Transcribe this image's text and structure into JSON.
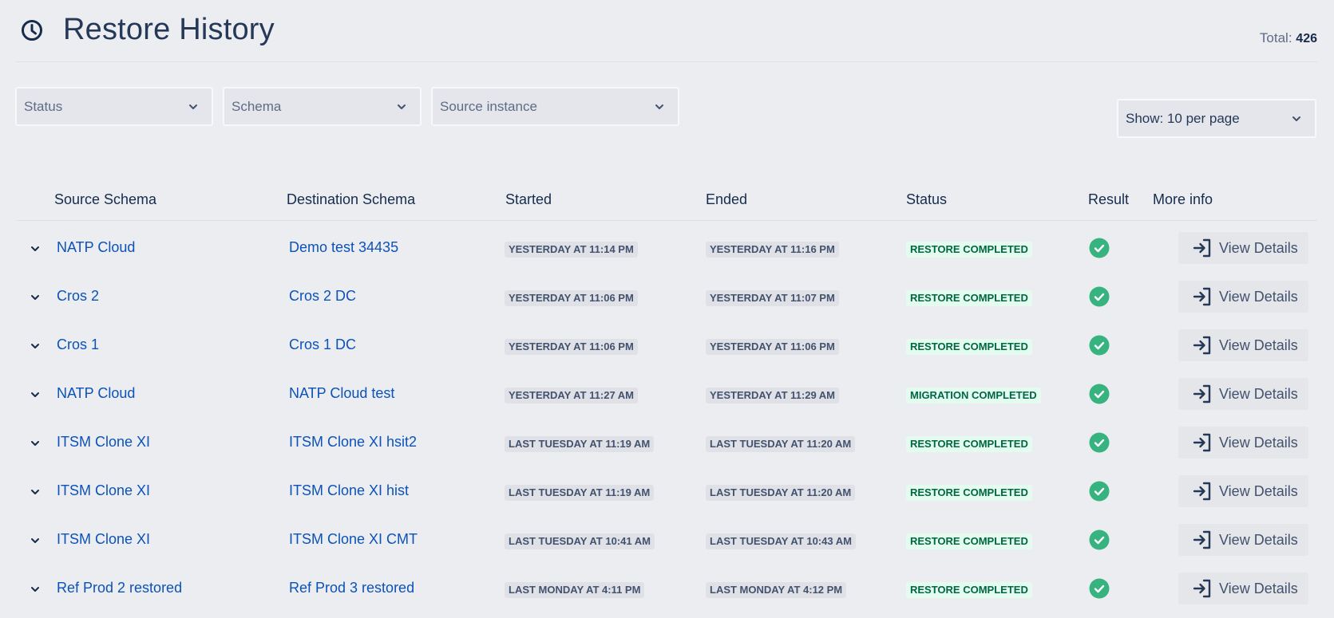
{
  "header": {
    "title": "Restore History",
    "total_label": "Total:",
    "total_value": "426",
    "icon": "clock-icon"
  },
  "filters": {
    "status_placeholder": "Status",
    "schema_placeholder": "Schema",
    "source_instance_placeholder": "Source instance",
    "page_size": "Show: 10 per page"
  },
  "table": {
    "columns": [
      "Source Schema",
      "Destination Schema",
      "Started",
      "Ended",
      "Status",
      "Result",
      "More info"
    ],
    "view_details_label": "View Details",
    "rows": [
      {
        "source": "NATP Cloud",
        "destination": "Demo test 34435",
        "started": "YESTERDAY AT 11:14 PM",
        "ended": "YESTERDAY AT 11:16 PM",
        "status": "RESTORE COMPLETED"
      },
      {
        "source": "Cros 2",
        "destination": "Cros 2 DC",
        "started": "YESTERDAY AT 11:06 PM",
        "ended": "YESTERDAY AT 11:07 PM",
        "status": "RESTORE COMPLETED"
      },
      {
        "source": "Cros 1",
        "destination": "Cros 1 DC",
        "started": "YESTERDAY AT 11:06 PM",
        "ended": "YESTERDAY AT 11:06 PM",
        "status": "RESTORE COMPLETED"
      },
      {
        "source": "NATP Cloud",
        "destination": "NATP Cloud test",
        "started": "YESTERDAY AT 11:27 AM",
        "ended": "YESTERDAY AT 11:29 AM",
        "status": "MIGRATION COMPLETED"
      },
      {
        "source": "ITSM Clone XI",
        "destination": "ITSM Clone XI hsit2",
        "started": "LAST TUESDAY AT 11:19 AM",
        "ended": "LAST TUESDAY AT 11:20 AM",
        "status": "RESTORE COMPLETED"
      },
      {
        "source": "ITSM Clone XI",
        "destination": "ITSM Clone XI hist",
        "started": "LAST TUESDAY AT 11:19 AM",
        "ended": "LAST TUESDAY AT 11:20 AM",
        "status": "RESTORE COMPLETED"
      },
      {
        "source": "ITSM Clone XI",
        "destination": "ITSM Clone XI CMT",
        "started": "LAST TUESDAY AT 10:41 AM",
        "ended": "LAST TUESDAY AT 10:43 AM",
        "status": "RESTORE COMPLETED"
      },
      {
        "source": "Ref Prod 2 restored",
        "destination": "Ref Prod 3 restored",
        "started": "LAST MONDAY AT 4:11 PM",
        "ended": "LAST MONDAY AT 4:12 PM",
        "status": "RESTORE COMPLETED"
      }
    ]
  },
  "colors": {
    "background": "#ebedf1",
    "link": "#0c52b8",
    "success": "#36b37e",
    "success_lozenge_bg": "#e3fcef",
    "success_lozenge_text": "#006644"
  }
}
